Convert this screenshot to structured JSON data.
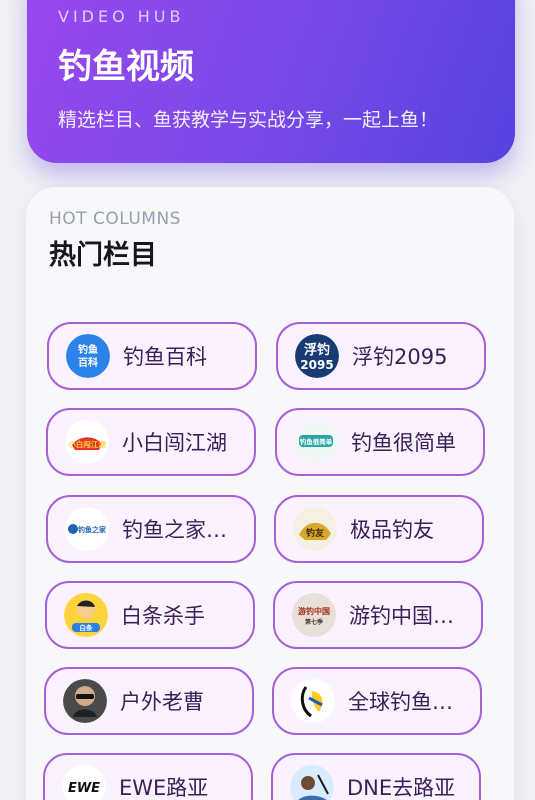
{
  "hero": {
    "kicker": "VIDEO HUB",
    "title": "钓鱼视频",
    "subtitle": "精选栏目、鱼获教学与实战分享，一起上鱼！"
  },
  "hot_columns": {
    "kicker": "HOT COLUMNS",
    "title": "热门栏目",
    "items": [
      {
        "label": "钓鱼百科",
        "avatar_text": "钓鱼百科",
        "avatar_color": "#2b82e8",
        "icon": "fishing-encyclopedia-logo-icon"
      },
      {
        "label": "浮钓2095",
        "avatar_text": "浮钓 2095",
        "avatar_color": "#183b73",
        "icon": "float-fishing-logo-icon"
      },
      {
        "label": "小白闯江湖",
        "avatar_text": "小白闯江湖",
        "avatar_color": "#ffffff",
        "icon": "xiaobai-adventure-logo-icon"
      },
      {
        "label": "钓鱼很简单",
        "avatar_text": "钓鱼很简单",
        "avatar_color": "#f1f7f5",
        "icon": "simple-fishing-logo-icon"
      },
      {
        "label": "钓鱼之家…",
        "avatar_text": "钓鱼之家",
        "avatar_color": "#ffffff",
        "icon": "fishing-home-logo-icon"
      },
      {
        "label": "极品钓友",
        "avatar_text": "钓友",
        "avatar_color": "#f5f0e2",
        "icon": "top-angler-logo-icon"
      },
      {
        "label": "白条杀手",
        "avatar_text": "白条",
        "avatar_color": "#ffd43b",
        "icon": "cartoon-fisher-avatar-icon"
      },
      {
        "label": "游钓中国…",
        "avatar_text": "游钓中国",
        "avatar_color": "#e7dfd8",
        "icon": "travel-fishing-china-logo-icon"
      },
      {
        "label": "户外老曹",
        "avatar_text": "",
        "avatar_color": "#4a4a4a",
        "icon": "outdoor-host-avatar-icon"
      },
      {
        "label": "全球钓鱼…",
        "avatar_text": "",
        "avatar_color": "#ffffff",
        "icon": "global-fishing-logo-icon"
      },
      {
        "label": "EWE路亚",
        "avatar_text": "EWE",
        "avatar_color": "#ffffff",
        "icon": "ewe-logo-icon"
      },
      {
        "label": "DNE去路亚",
        "avatar_text": "",
        "avatar_color": "#d9ecff",
        "icon": "dne-lure-logo-icon"
      }
    ]
  }
}
